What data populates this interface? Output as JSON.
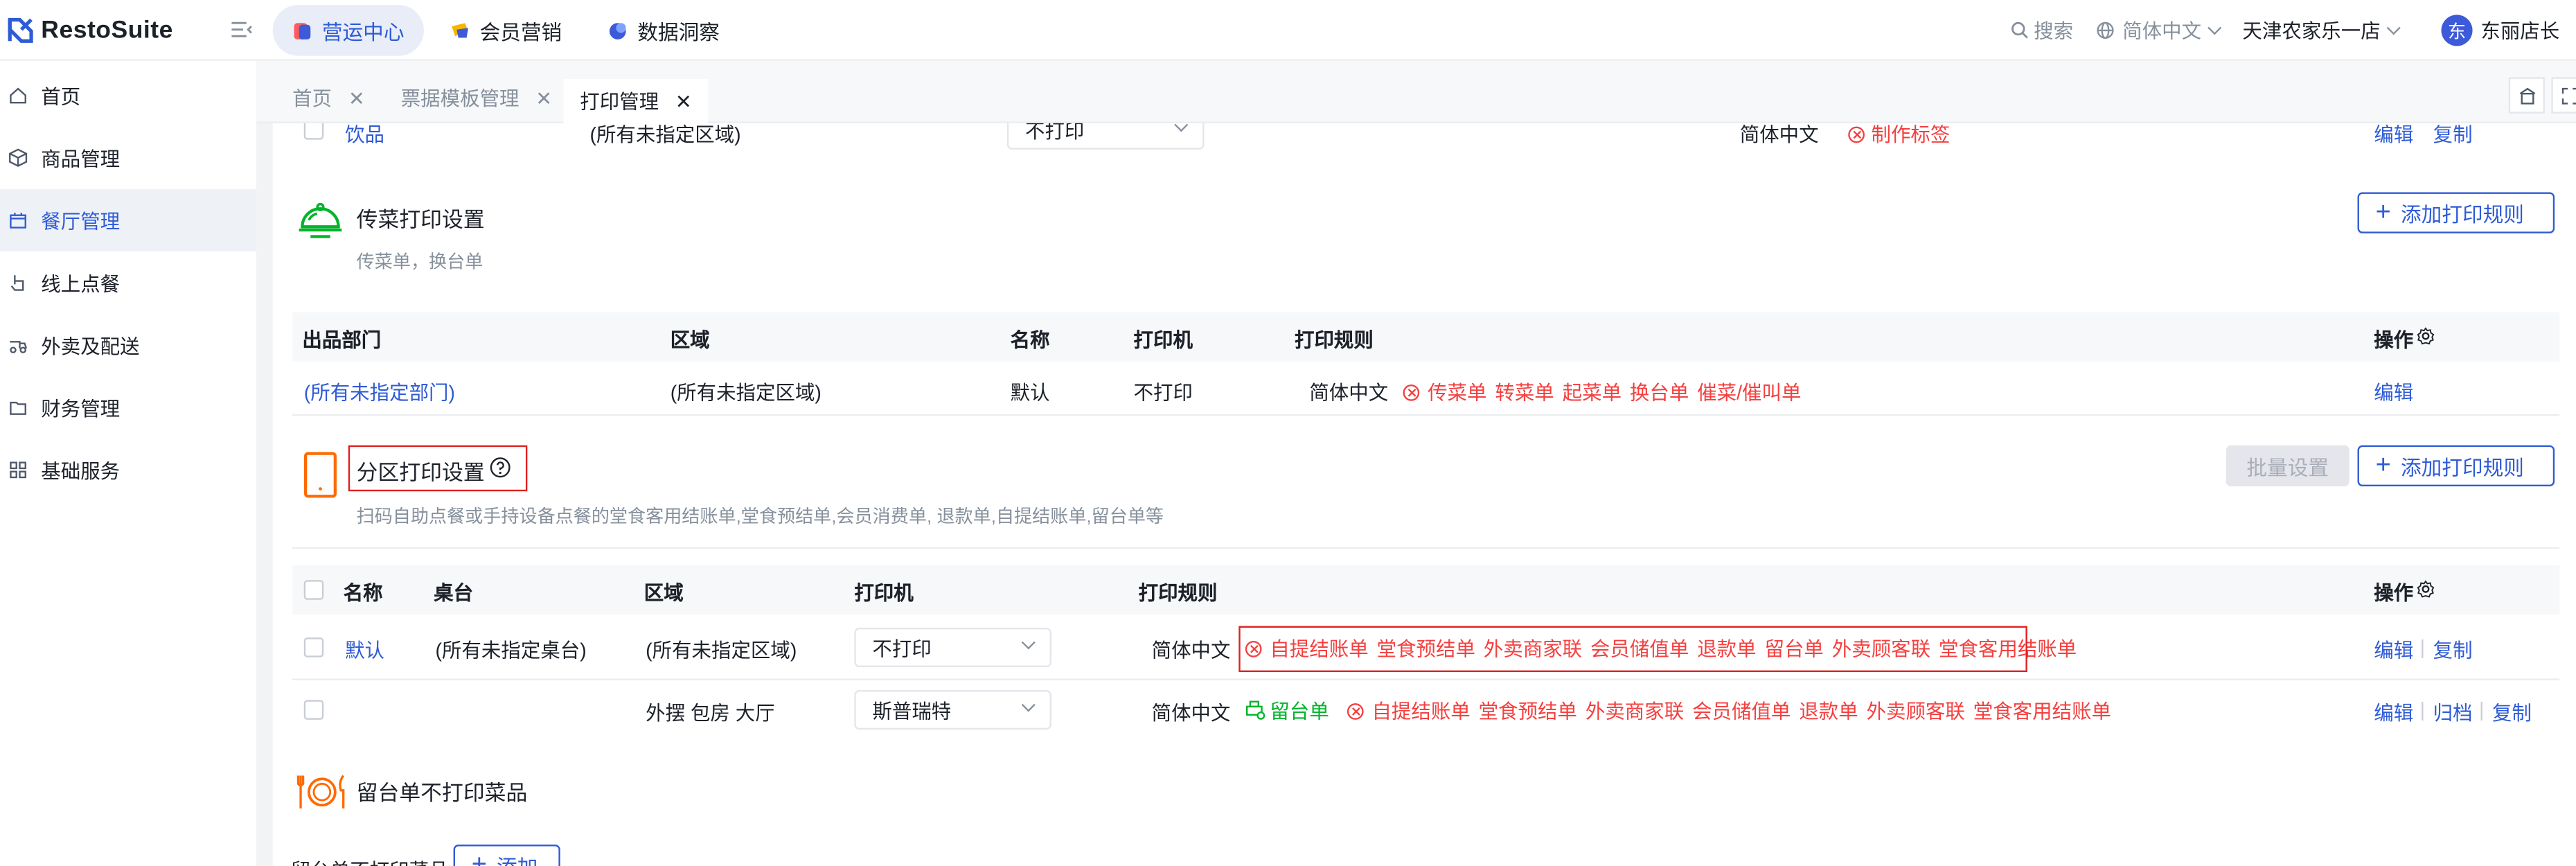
{
  "brand": {
    "name": "RestoSuite"
  },
  "topnav": [
    {
      "label": "营运中心",
      "active": true
    },
    {
      "label": "会员营销",
      "active": false
    },
    {
      "label": "数据洞察",
      "active": false
    }
  ],
  "header": {
    "search": "搜索",
    "language": "简体中文",
    "store": "天津农家乐一店",
    "avatar": "东",
    "user": "东丽店长"
  },
  "sidebar": [
    {
      "label": "首页",
      "icon": "home-icon",
      "active": false
    },
    {
      "label": "商品管理",
      "icon": "box-icon",
      "active": false
    },
    {
      "label": "餐厅管理",
      "icon": "store-icon",
      "active": true
    },
    {
      "label": "线上点餐",
      "icon": "hand-icon",
      "active": false
    },
    {
      "label": "外卖及配送",
      "icon": "delivery-icon",
      "active": false
    },
    {
      "label": "财务管理",
      "icon": "folder-icon",
      "active": false
    },
    {
      "label": "基础服务",
      "icon": "grid-icon",
      "active": false
    }
  ],
  "tabs": [
    {
      "label": "首页",
      "active": false
    },
    {
      "label": "票据模板管理",
      "active": false
    },
    {
      "label": "打印管理",
      "active": true
    }
  ],
  "partial_row": {
    "name": "饮品",
    "area": "(所有未指定区域)",
    "printer": "不打印",
    "lang": "简体中文",
    "rule": "制作标签",
    "actions": [
      "编辑",
      "复制"
    ]
  },
  "serve": {
    "title": "传菜打印设置",
    "desc": "传菜单，换台单",
    "add_label": "添加打印规则",
    "columns": [
      "出品部门",
      "区域",
      "名称",
      "打印机",
      "打印规则",
      "操作"
    ],
    "row": {
      "dept": "(所有未指定部门)",
      "area": "(所有未指定区域)",
      "name": "默认",
      "printer": "不打印",
      "lang": "简体中文",
      "rules": [
        "传菜单",
        "转菜单",
        "起菜单",
        "换台单",
        "催菜/催叫单"
      ],
      "action": "编辑"
    }
  },
  "zone": {
    "title": "分区打印设置",
    "desc": "扫码自助点餐或手持设备点餐的堂食客用结账单,堂食预结单,会员消费单, 退款单,自提结账单,留台单等",
    "batch_label": "批量设置",
    "add_label": "添加打印规则",
    "columns": [
      "名称",
      "桌台",
      "区域",
      "打印机",
      "打印规则",
      "操作"
    ],
    "rows": [
      {
        "name": "默认",
        "table": "(所有未指定桌台)",
        "area": "(所有未指定区域)",
        "printer": "不打印",
        "lang": "简体中文",
        "ok_rules": [],
        "rules": [
          "自提结账单",
          "堂食预结单",
          "外卖商家联",
          "会员储值单",
          "退款单",
          "留台单",
          "外卖顾客联",
          "堂食客用结账单"
        ],
        "actions": [
          "编辑",
          "复制"
        ]
      },
      {
        "name": "",
        "table": "",
        "area": "外摆 包房 大厅",
        "printer": "斯普瑞特",
        "lang": "简体中文",
        "ok_rules": [
          "留台单"
        ],
        "rules": [
          "自提结账单",
          "堂食预结单",
          "外卖商家联",
          "会员储值单",
          "退款单",
          "外卖顾客联",
          "堂食客用结账单"
        ],
        "actions": [
          "编辑",
          "归档",
          "复制"
        ]
      }
    ]
  },
  "hold": {
    "title": "留台单不打印菜品",
    "field_label": "留台单不打印菜品:",
    "add_label": "添加"
  }
}
